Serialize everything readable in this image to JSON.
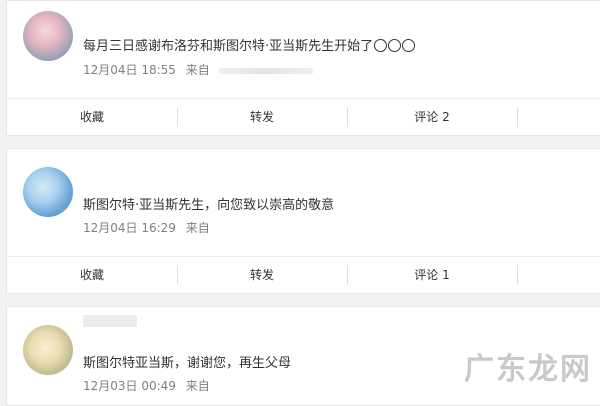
{
  "posts": [
    {
      "message": "每月三日感谢布洛芬和斯图尔特·亚当斯先生开始了",
      "date": "12月04日 18:55",
      "from_label": "来自",
      "actions": [
        "收藏",
        "转发",
        "评论 2",
        ""
      ]
    },
    {
      "message": "斯图尔特·亚当斯先生，向您致以崇高的敬意",
      "date": "12月04日 16:29",
      "from_label": "来自",
      "actions": [
        "收藏",
        "转发",
        "评论 1",
        ""
      ]
    },
    {
      "message": "斯图尔特亚当斯，谢谢您，再生父母",
      "date": "12月03日 00:49",
      "from_label": "来自"
    }
  ],
  "watermark": "广东龙网",
  "icons": [
    "emoji-face-icon",
    "emoji-face-icon",
    "emoji-face-icon"
  ]
}
